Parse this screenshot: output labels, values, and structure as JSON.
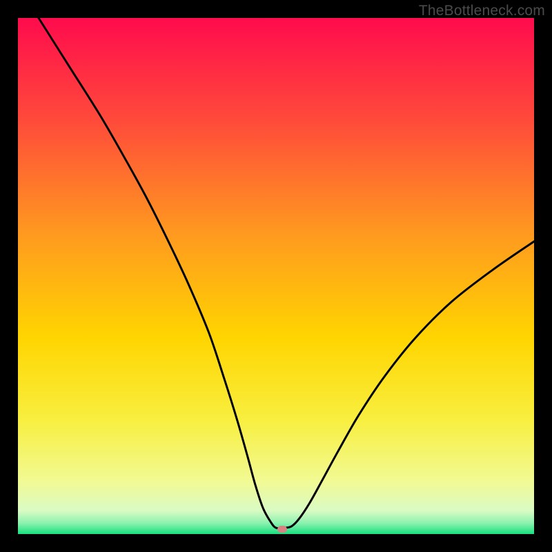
{
  "watermark": {
    "text": "TheBottleneck.com"
  },
  "chart_data": {
    "type": "line",
    "title": "",
    "xlabel": "",
    "ylabel": "",
    "xlim": [
      0,
      100
    ],
    "ylim": [
      0,
      100
    ],
    "grid": false,
    "background_gradient_stops": [
      {
        "pos": 0.0,
        "color": "#ff0b4d"
      },
      {
        "pos": 0.2,
        "color": "#ff4b3a"
      },
      {
        "pos": 0.42,
        "color": "#ff9a1f"
      },
      {
        "pos": 0.62,
        "color": "#ffd500"
      },
      {
        "pos": 0.78,
        "color": "#f8ef40"
      },
      {
        "pos": 0.9,
        "color": "#f1fa95"
      },
      {
        "pos": 0.955,
        "color": "#d9fbc4"
      },
      {
        "pos": 0.978,
        "color": "#8ef2b0"
      },
      {
        "pos": 1.0,
        "color": "#18e07f"
      }
    ],
    "series": [
      {
        "name": "bottleneck-curve",
        "color": "#000000",
        "stroke_width": 3,
        "x": [
          4,
          10,
          16,
          21,
          25,
          29,
          33,
          37,
          40,
          42.5,
          44.5,
          46,
          47.5,
          49,
          50,
          51.5,
          53,
          54.5,
          56.5,
          59,
          62,
          66,
          71,
          77,
          84,
          92,
          100
        ],
        "y": [
          100,
          90.5,
          81,
          72.3,
          65,
          57,
          48.5,
          39,
          30,
          22,
          15,
          9.5,
          5,
          2.3,
          1.2,
          1.2,
          1.5,
          3,
          6,
          10.5,
          16,
          23,
          30.5,
          38,
          45,
          51.2,
          56.7
        ]
      }
    ],
    "marker": {
      "x": 51.2,
      "y": 1.0,
      "color": "#d88383"
    }
  }
}
